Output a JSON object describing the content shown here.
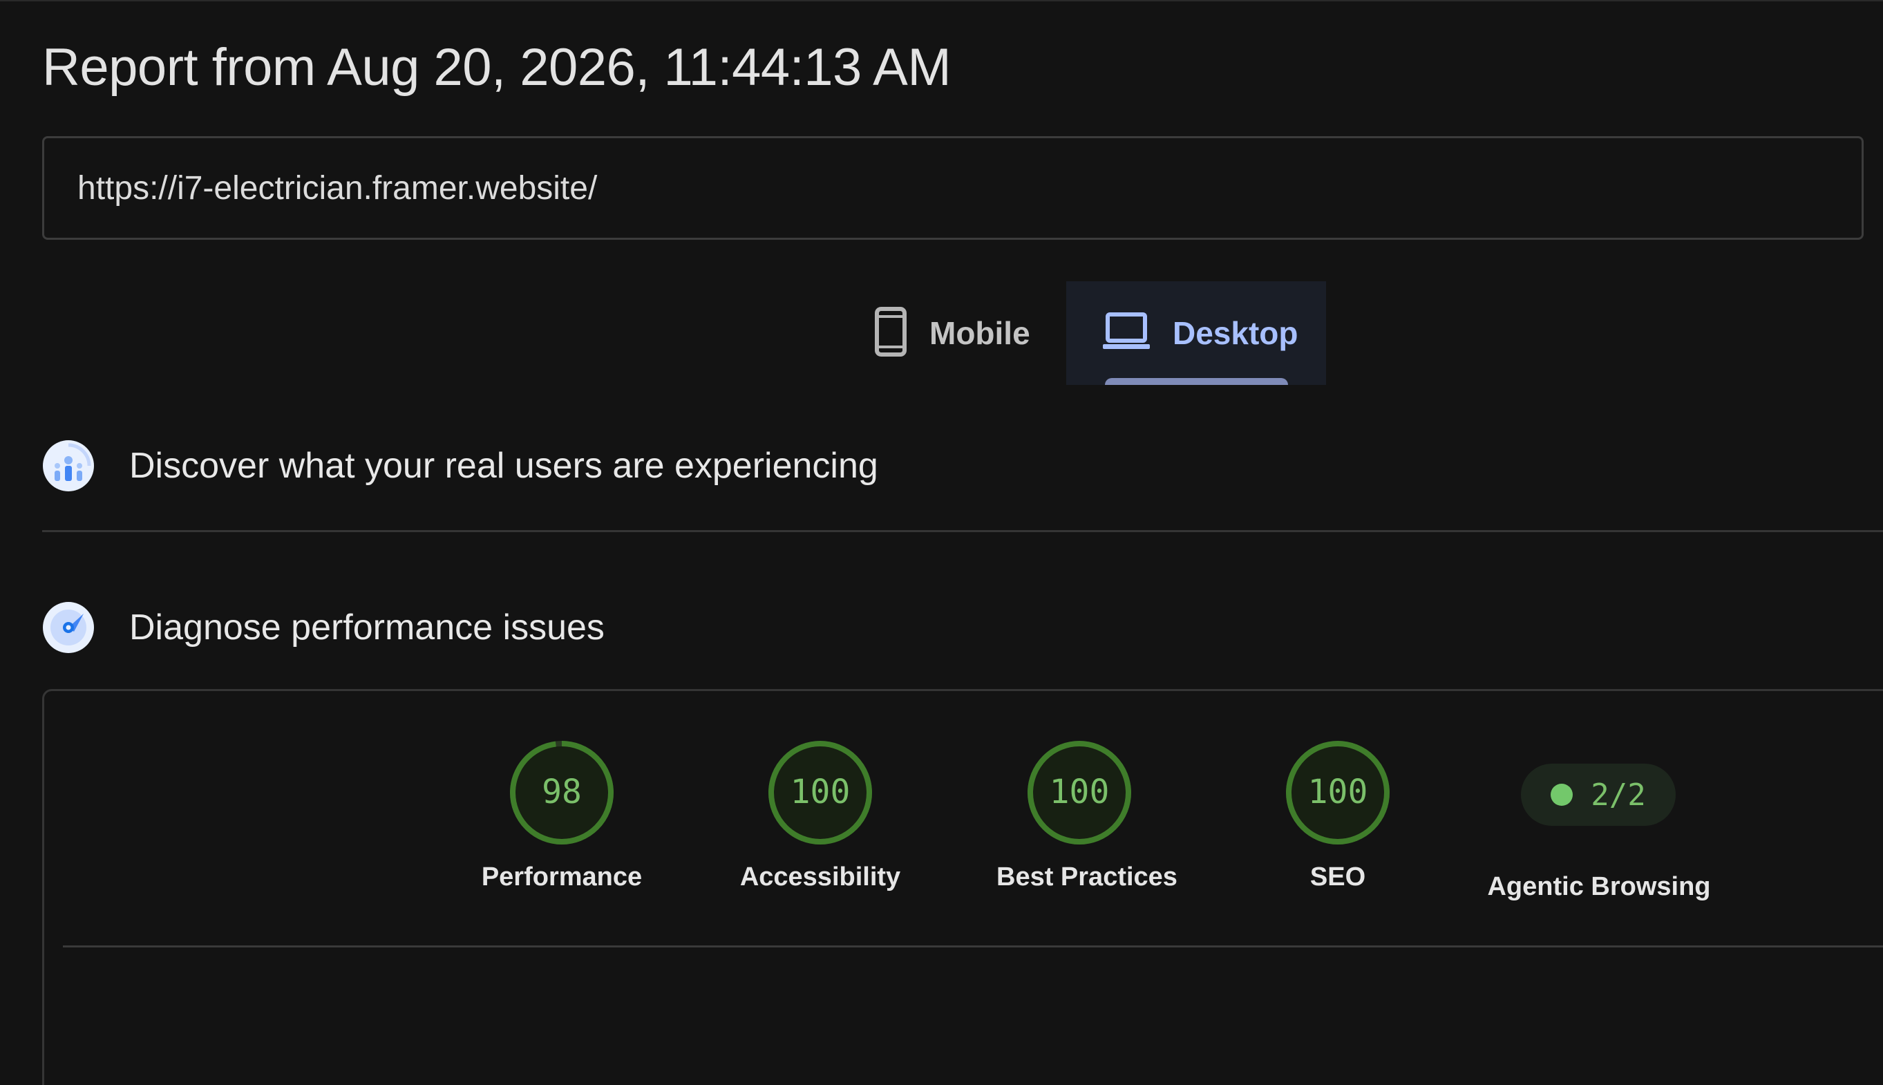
{
  "report": {
    "title": "Report from Aug 20, 2026, 11:44:13 AM",
    "url": "https://i7-electrician.framer.website/"
  },
  "device_tabs": [
    {
      "label": "Mobile",
      "icon": "smartphone-icon",
      "selected": false
    },
    {
      "label": "Desktop",
      "icon": "laptop-icon",
      "selected": true
    }
  ],
  "sections": {
    "discover": {
      "title": "Discover what your real users are experiencing",
      "icon": "crux-users-icon"
    },
    "diagnose": {
      "title": "Diagnose performance issues",
      "icon": "lighthouse-gauge-icon"
    }
  },
  "scores": [
    {
      "label": "Performance",
      "score": "98",
      "fraction": 0.98
    },
    {
      "label": "Accessibility",
      "score": "100",
      "fraction": 1.0
    },
    {
      "label": "Best Practices",
      "score": "100",
      "fraction": 1.0
    },
    {
      "label": "SEO",
      "score": "100",
      "fraction": 1.0
    }
  ],
  "agentic": {
    "label": "Agentic Browsing",
    "value": "2/2"
  },
  "colors": {
    "pass_green": "#7bc06a",
    "gauge_track": "#2a3a22",
    "gauge_arc": "#3f7d2a",
    "accent_blue": "#a8c0ff"
  }
}
